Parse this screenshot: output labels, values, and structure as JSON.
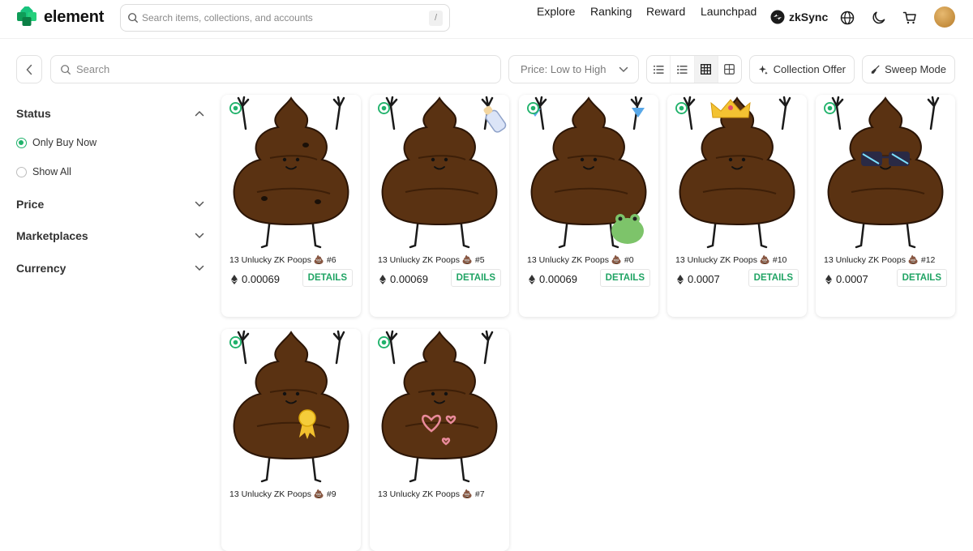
{
  "brand": {
    "name": "element",
    "accent": "#20b26b"
  },
  "header": {
    "search_placeholder": "Search items, collections, and accounts",
    "search_shortcut": "/",
    "nav": [
      "Explore",
      "Ranking",
      "Reward",
      "Launchpad"
    ],
    "chain": "zkSync",
    "icons": [
      "globe-icon",
      "moon-icon",
      "cart-icon"
    ]
  },
  "toolbar": {
    "search_placeholder": "Search",
    "sort_label": "Price: Low to High",
    "view_modes": [
      "list-view-icon",
      "detail-list-icon",
      "grid-view-icon",
      "large-grid-icon"
    ],
    "active_view": "grid-view-icon",
    "collection_offer": "Collection Offer",
    "sweep_mode": "Sweep Mode"
  },
  "filters": {
    "status": {
      "label": "Status",
      "options": [
        "Only Buy Now",
        "Show All"
      ],
      "selected": "Only Buy Now"
    },
    "price": "Price",
    "marketplaces": "Marketplaces",
    "currency": "Currency"
  },
  "items": [
    {
      "title": "13 Unlucky ZK Poops 💩 #6",
      "price": "0.00069",
      "action": "DETAILS",
      "accessory": "bugs"
    },
    {
      "title": "13 Unlucky ZK Poops 💩 #5",
      "price": "0.00069",
      "action": "DETAILS",
      "accessory": "bottle"
    },
    {
      "title": "13 Unlucky ZK Poops 💩 #0",
      "price": "0.00069",
      "action": "DETAILS",
      "accessory": "frog"
    },
    {
      "title": "13 Unlucky ZK Poops 💩 #10",
      "price": "0.0007",
      "action": "DETAILS",
      "accessory": "crown"
    },
    {
      "title": "13 Unlucky ZK Poops 💩 #12",
      "price": "0.0007",
      "action": "DETAILS",
      "accessory": "glasses"
    },
    {
      "title": "13 Unlucky ZK Poops 💩 #9",
      "price": "",
      "action": "",
      "accessory": "ribbon"
    },
    {
      "title": "13 Unlucky ZK Poops 💩 #7",
      "price": "",
      "action": "",
      "accessory": "hearts"
    }
  ]
}
